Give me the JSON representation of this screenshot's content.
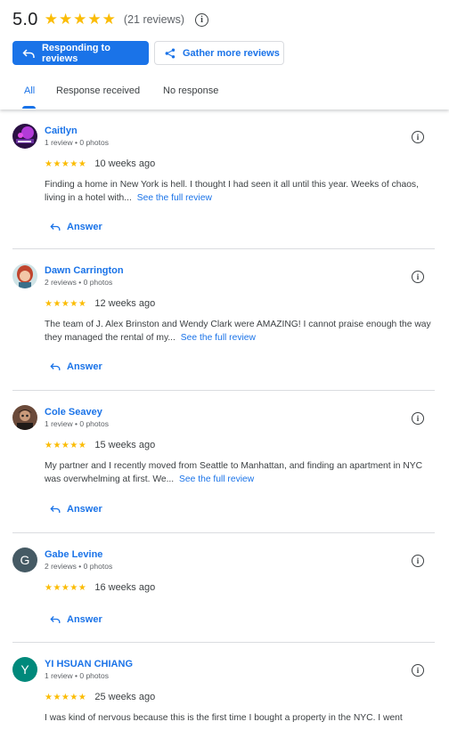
{
  "summary": {
    "rating": "5.0",
    "stars": "★★★★★",
    "review_count": "(21 reviews)",
    "info_glyph": "i"
  },
  "actions": {
    "responding_label": "Responding to reviews",
    "gather_label": "Gather more reviews"
  },
  "tabs": [
    {
      "label": "All",
      "active": true
    },
    {
      "label": "Response received",
      "active": false
    },
    {
      "label": "No response",
      "active": false
    }
  ],
  "colors": {
    "accent": "#1a73e8",
    "star": "#fbbc04",
    "divider": "#dadce0"
  },
  "reviews": [
    {
      "name": "Caitlyn",
      "meta": "1 review • 0 photos",
      "stars": "★★★★★",
      "ago": "10  weeks ago",
      "text": "Finding a home in New York is hell. I thought I had seen it all until this year. Weeks of chaos, living in a hotel with...",
      "see_full": "See the full review",
      "answer": "Answer",
      "avatar_icon": "purple-graphic-avatar"
    },
    {
      "name": "Dawn Carrington",
      "meta": "2 reviews • 0 photos",
      "stars": "★★★★★",
      "ago": "12  weeks ago",
      "text": "The team of J. Alex Brinston and Wendy Clark were AMAZING! I cannot praise enough the way they managed the rental of my...",
      "see_full": "See the full review",
      "answer": "Answer",
      "avatar_icon": "red-hair-portrait-avatar"
    },
    {
      "name": "Cole Seavey",
      "meta": "1 review • 0 photos",
      "stars": "★★★★★",
      "ago": "15  weeks ago",
      "text": "My partner and I recently moved from Seattle to Manhattan, and finding an apartment in NYC was overwhelming at first. We...",
      "see_full": "See the full review",
      "answer": "Answer",
      "avatar_icon": "photo-portrait-avatar"
    },
    {
      "name": "Gabe Levine",
      "meta": "2 reviews • 0 photos",
      "stars": "★★★★★",
      "ago": "16  weeks ago",
      "text": "",
      "see_full": "",
      "answer": "Answer",
      "avatar_letter": "G",
      "avatar_color": "#455a64"
    },
    {
      "name": "YI HSUAN CHIANG",
      "meta": "1 review • 0 photos",
      "stars": "★★★★★",
      "ago": "25  weeks ago",
      "text": "I was kind of nervous because this is the first time I bought a property in the NYC. I went",
      "see_full": "",
      "answer": "",
      "avatar_letter": "Y",
      "avatar_color": "#00897b"
    }
  ]
}
